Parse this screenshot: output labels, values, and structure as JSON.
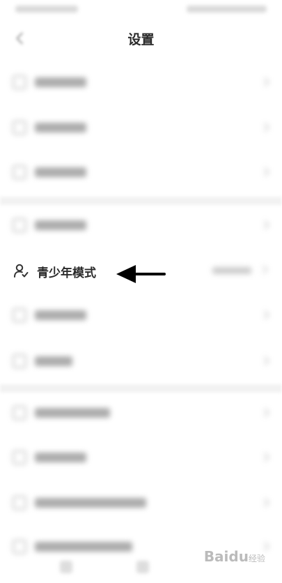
{
  "header": {
    "title": "设置",
    "back_icon": "arrow-left-icon"
  },
  "youth_mode": {
    "label": "青少年模式",
    "icon": "user-check-icon"
  },
  "annotation": {
    "arrow_icon": "arrow-left-icon",
    "color": "#000000"
  },
  "watermark": {
    "brand": "Bai",
    "paw": "du",
    "suffix": "经验"
  }
}
